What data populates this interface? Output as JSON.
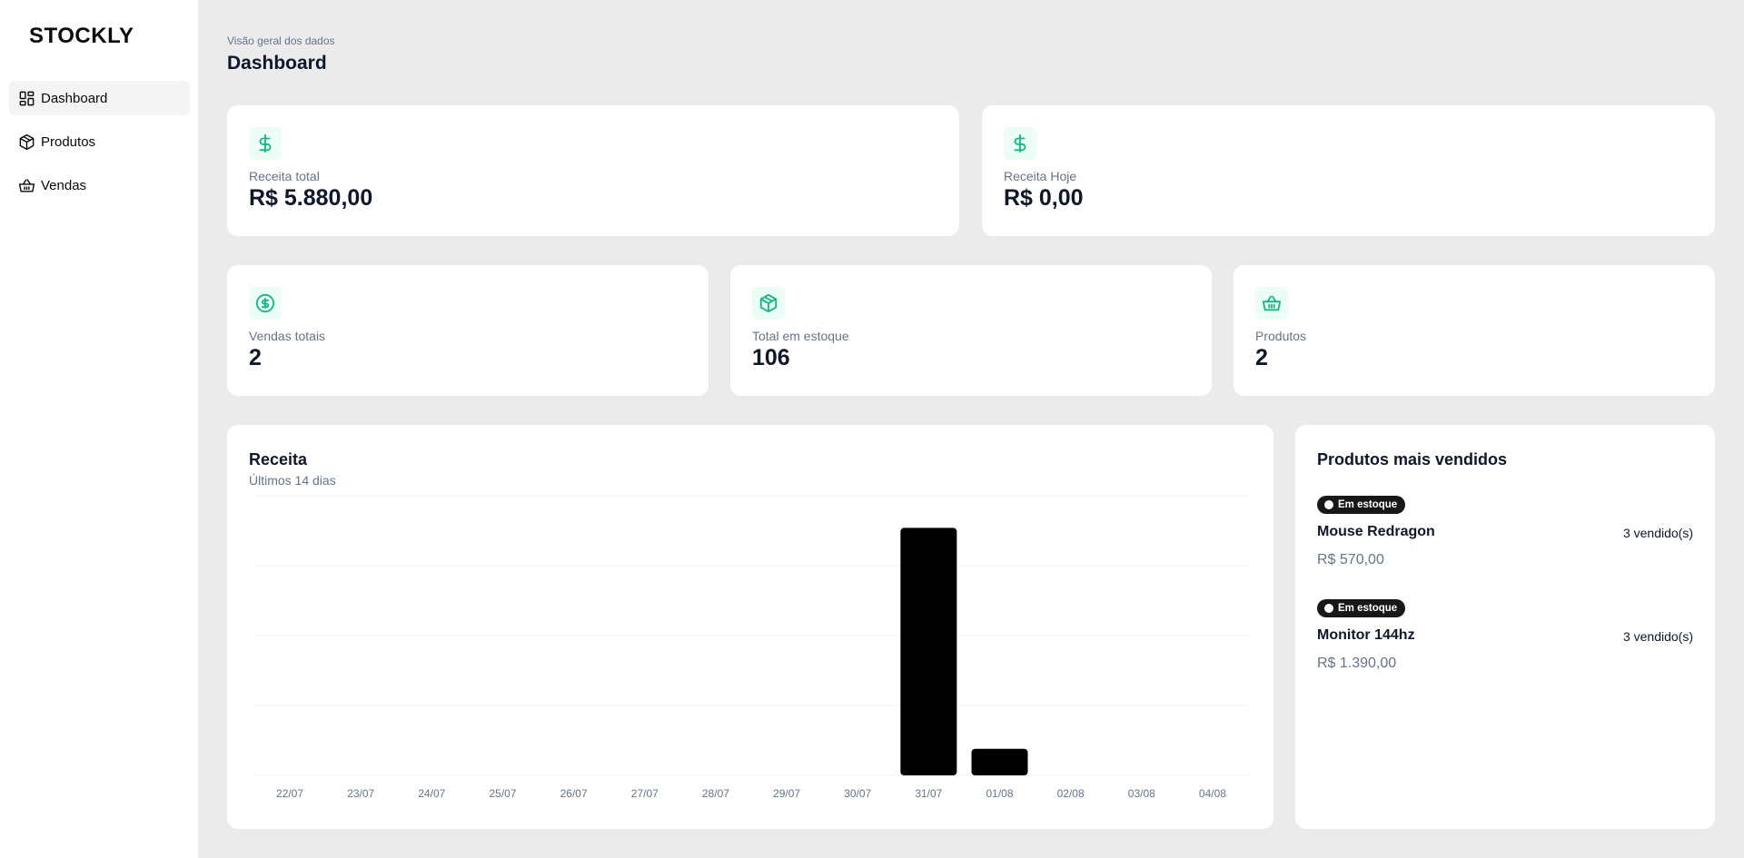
{
  "app": {
    "name": "STOCKLY"
  },
  "sidebar": {
    "items": [
      {
        "label": "Dashboard",
        "icon": "dashboard-grid-icon",
        "active": true
      },
      {
        "label": "Produtos",
        "icon": "package-icon",
        "active": false
      },
      {
        "label": "Vendas",
        "icon": "shopping-basket-icon",
        "active": false
      }
    ]
  },
  "header": {
    "subtitle": "Visão geral dos dados",
    "title": "Dashboard"
  },
  "stats": {
    "revenue_total": {
      "label": "Receita total",
      "value": "R$ 5.880,00",
      "icon": "dollar-sign-icon"
    },
    "revenue_today": {
      "label": "Receita Hoje",
      "value": "R$ 0,00",
      "icon": "dollar-sign-icon"
    },
    "sales_total": {
      "label": "Vendas totais",
      "value": "2",
      "icon": "circle-dollar-icon"
    },
    "stock_total": {
      "label": "Total em estoque",
      "value": "106",
      "icon": "package-icon"
    },
    "products": {
      "label": "Produtos",
      "value": "2",
      "icon": "shopping-basket-icon"
    }
  },
  "chart_panel": {
    "title": "Receita",
    "subtitle": "Últimos 14 dias"
  },
  "chart_data": {
    "type": "bar",
    "title": "Receita",
    "subtitle": "Últimos 14 dias",
    "categories": [
      "22/07",
      "23/07",
      "24/07",
      "25/07",
      "26/07",
      "27/07",
      "28/07",
      "29/07",
      "30/07",
      "31/07",
      "01/08",
      "02/08",
      "03/08",
      "04/08"
    ],
    "values": [
      0,
      0,
      0,
      0,
      0,
      0,
      0,
      0,
      0,
      5310,
      570,
      0,
      0,
      0
    ],
    "ylim": [
      0,
      6000
    ],
    "grid": true,
    "bar_color": "#000000"
  },
  "top_products": {
    "title": "Produtos mais vendidos",
    "items": [
      {
        "status": "Em estoque",
        "name": "Mouse Redragon",
        "sold": "3 vendido(s)",
        "price": "R$ 570,00"
      },
      {
        "status": "Em estoque",
        "name": "Monitor 144hz",
        "sold": "3 vendido(s)",
        "price": "R$ 1.390,00"
      }
    ]
  },
  "colors": {
    "accent": "#10b981",
    "accent_bg": "#ecfdf5",
    "background": "#ebebeb",
    "badge": "#18181b"
  }
}
